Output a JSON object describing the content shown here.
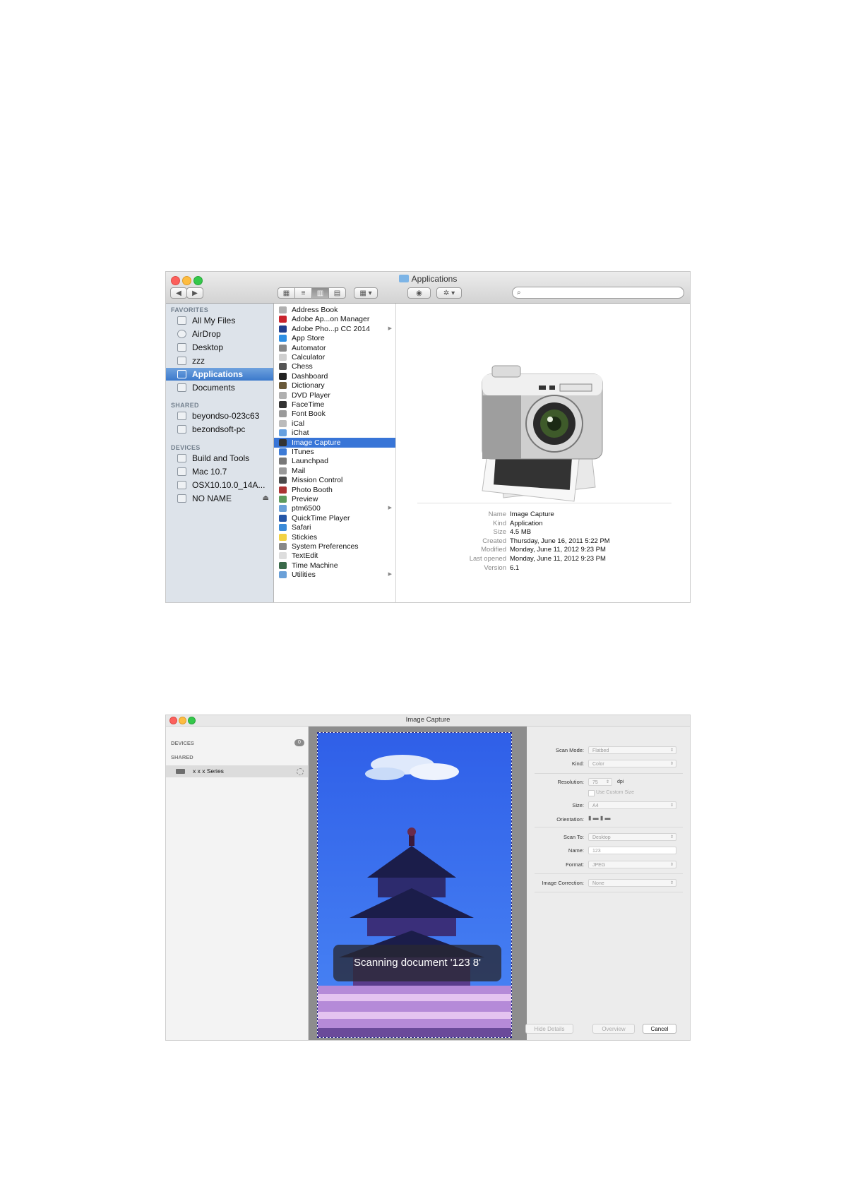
{
  "finder": {
    "title": "Applications",
    "sidebar": {
      "favorites_header": "FAVORITES",
      "favorites": [
        "All My Files",
        "AirDrop",
        "Desktop",
        "zzz",
        "Applications",
        "Documents"
      ],
      "shared_header": "SHARED",
      "shared": [
        "beyondso-023c63",
        "bezondsoft-pc"
      ],
      "devices_header": "DEVICES",
      "devices": [
        "Build and Tools",
        "Mac 10.7",
        "OSX10.10.0_14A...",
        "NO NAME"
      ]
    },
    "apps": [
      "Address Book",
      "Adobe Ap...on Manager",
      "Adobe Pho...p CC 2014",
      "App Store",
      "Automator",
      "Calculator",
      "Chess",
      "Dashboard",
      "Dictionary",
      "DVD Player",
      "FaceTime",
      "Font Book",
      "iCal",
      "iChat",
      "Image Capture",
      "ITunes",
      "Launchpad",
      "Mail",
      "Mission Control",
      "Photo Booth",
      "Preview",
      "ptm6500",
      "QuickTime Player",
      "Safari",
      "Stickies",
      "System Preferences",
      "TextEdit",
      "Time Machine",
      "Utilities"
    ],
    "info": {
      "name_k": "Name",
      "name_v": "Image Capture",
      "kind_k": "Kind",
      "kind_v": "Application",
      "size_k": "Size",
      "size_v": "4.5 MB",
      "created_k": "Created",
      "created_v": "Thursday, June 16, 2011 5:22 PM",
      "modified_k": "Modified",
      "modified_v": "Monday, June 11, 2012 9:23 PM",
      "opened_k": "Last opened",
      "opened_v": "Monday, June 11, 2012 9:23 PM",
      "version_k": "Version",
      "version_v": "6.1"
    }
  },
  "image_capture": {
    "title": "Image Capture",
    "devices_header": "DEVICES",
    "devices_count": "0",
    "shared_header": "SHARED",
    "device_name": "x x x  Series",
    "scan_message": "Scanning document '123 8'",
    "options": {
      "scan_mode_label": "Scan Mode:",
      "scan_mode_value": "Flatbed",
      "kind_label": "Kind:",
      "kind_value": "Color",
      "resolution_label": "Resolution:",
      "resolution_value": "75",
      "resolution_unit": "dpi",
      "custom_size_label": "Use Custom Size",
      "size_label": "Size:",
      "size_value": "A4",
      "orientation_label": "Orientation:",
      "scan_to_label": "Scan To:",
      "scan_to_value": "Desktop",
      "name_label": "Name:",
      "name_value": "123",
      "format_label": "Format:",
      "format_value": "JPEG",
      "correction_label": "Image Correction:",
      "correction_value": "None"
    },
    "buttons": {
      "hide_details": "Hide Details",
      "overview": "Overview",
      "cancel": "Cancel"
    }
  }
}
